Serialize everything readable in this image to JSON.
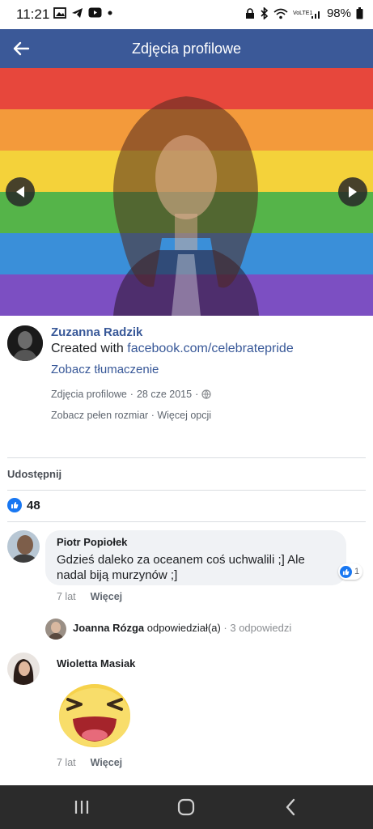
{
  "status_bar": {
    "time": "11:21",
    "battery": "98%",
    "network": "VoLTE1",
    "left_icons": [
      "gallery-icon",
      "telegram-icon",
      "youtube-icon",
      "dot-icon"
    ],
    "right_icons": [
      "lock-icon",
      "bluetooth-icon",
      "wifi-icon",
      "signal-icon",
      "battery-icon"
    ]
  },
  "app_bar": {
    "title": "Zdjęcia profilowe",
    "back_icon": "back-arrow-icon",
    "color": "#3b5998"
  },
  "photo": {
    "stripe_colors": [
      "#e7473c",
      "#f39a3b",
      "#f4d23a",
      "#55b449",
      "#3a8fd9",
      "#7c4fc2"
    ],
    "prev_icon": "chevron-left-icon",
    "next_icon": "chevron-right-icon"
  },
  "post": {
    "author": "Zuzanna Radzik",
    "caption_prefix": "Created with ",
    "caption_link": "facebook.com/celebratepride",
    "translate": "Zobacz tłumaczenie",
    "meta_album": "Zdjęcia profilowe",
    "meta_sep": "·",
    "meta_date": "28 cze 2015",
    "meta_sep2": "·",
    "full_size": "Zobacz pełen rozmiar",
    "options_sep": "·",
    "more_options": "Więcej opcji"
  },
  "share_label": "Udostępnij",
  "likes_count": "48",
  "comments": [
    {
      "author": "Piotr Popiołek",
      "text": "Gdzieś daleko za oceanem coś uchwalili ;] Ale nadal biją murzynów ;]",
      "time": "7 lat",
      "more": "Więcej",
      "reaction_count": "1"
    },
    {
      "author": "Wioletta Masiak",
      "time": "7 lat",
      "more": "Więcej"
    }
  ],
  "reply": {
    "author": "Joanna Rózga",
    "action": " odpowiedział(a) ",
    "sep": "·",
    "count": " 3 odpowiedzi"
  },
  "navbar": {
    "icons": [
      "recent-apps-icon",
      "home-icon",
      "back-icon"
    ]
  }
}
